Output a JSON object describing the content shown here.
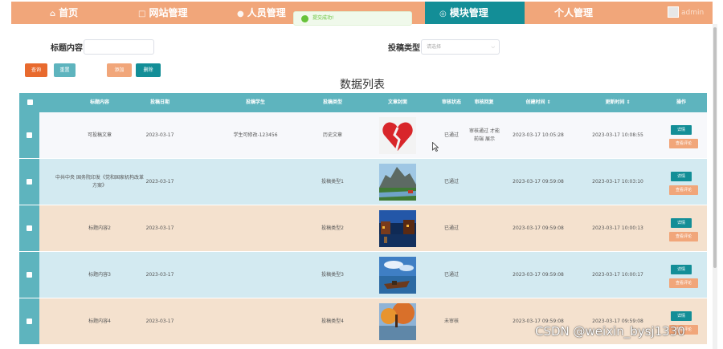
{
  "nav": {
    "items": [
      {
        "label": "首页",
        "icon": "home-icon",
        "glyph": "⌂"
      },
      {
        "label": "网站管理",
        "icon": "website-icon",
        "glyph": "□"
      },
      {
        "label": "人员管理",
        "icon": "person-icon",
        "glyph": "●"
      },
      {
        "label": "模块管理",
        "icon": "module-icon",
        "glyph": "◎"
      },
      {
        "label": "个人管理",
        "icon": "",
        "glyph": ""
      }
    ],
    "active_index": 3,
    "user": "admin"
  },
  "toast": {
    "text": "提交成功!",
    "icon": "success-check-icon"
  },
  "search": {
    "title_label": "标题内容",
    "title_value": "",
    "type_label": "投稿类型",
    "type_placeholder": "请选择"
  },
  "buttons": {
    "query": "查询",
    "reset": "重置",
    "add": "添加",
    "delete": "删除"
  },
  "list_title": "数据列表",
  "table": {
    "columns": [
      "标题内容",
      "投稿日期",
      "投稿学生",
      "投稿类型",
      "文章封面",
      "审核状态",
      "审核回复",
      "创建时间 ⇕",
      "更新时间 ⇕",
      "操作"
    ],
    "actions": {
      "detail": "详情",
      "review": "查看评论"
    },
    "rows": [
      {
        "title": "可投稿文章",
        "date": "2023-03-17",
        "student": "学生可修改-123456",
        "type": "历史文章",
        "status": "已通过",
        "reply": "审核通过 才能前端 展示",
        "created": "2023-03-17 10:05:28",
        "updated": "2023-03-17 10:08:55",
        "cover": "heart"
      },
      {
        "title": "中共中央 国务院印发《党和国家机构改革方案》",
        "date": "2023-03-17",
        "student": "",
        "type": "投稿类型1",
        "status": "已通过",
        "reply": "",
        "created": "2023-03-17 09:59:08",
        "updated": "2023-03-17 10:03:10",
        "cover": "mountain"
      },
      {
        "title": "标题内容2",
        "date": "2023-03-17",
        "student": "",
        "type": "投稿类型2",
        "status": "已通过",
        "reply": "",
        "created": "2023-03-17 09:59:08",
        "updated": "2023-03-17 10:00:13",
        "cover": "night"
      },
      {
        "title": "标题内容3",
        "date": "2023-03-17",
        "student": "",
        "type": "投稿类型3",
        "status": "已通过",
        "reply": "",
        "created": "2023-03-17 09:59:08",
        "updated": "2023-03-17 10:00:17",
        "cover": "boat"
      },
      {
        "title": "标题内容4",
        "date": "2023-03-17",
        "student": "",
        "type": "投稿类型4",
        "status": "未审核",
        "reply": "",
        "created": "2023-03-17 09:59:08",
        "updated": "2023-03-17 09:59:08",
        "cover": "autumn"
      }
    ]
  },
  "watermark": "CSDN @weixin_bysj1330",
  "colors": {
    "nav": "#f1a67a",
    "accent": "#138e97",
    "header": "#5eb4be",
    "query_btn": "#e86a2e",
    "reset_btn": "#5eb4be",
    "add_btn": "#f1a67a",
    "delete_btn": "#138e97",
    "row_white": "#f7f8fb",
    "row_blue": "#d3eaf1",
    "row_peach": "#f4e1ce"
  }
}
